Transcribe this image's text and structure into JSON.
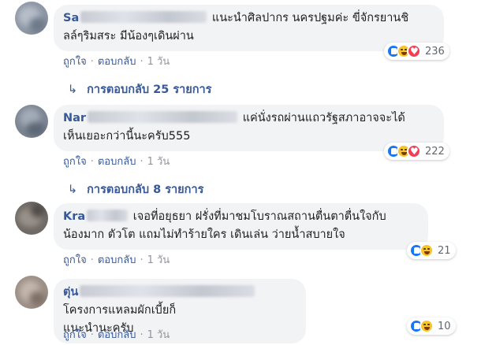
{
  "comments": [
    {
      "name": "Sa▒▒▒▒▒▒▒▒▒▒▒▒▒▒▒",
      "name_visible": "Sa",
      "line1": "แนะนำศิลปากร นครปฐมค่ะ ขี่จักรยานชิ",
      "line2": "ลล์ๆริมสระ มีน้องๆเดินผ่าน",
      "actions": {
        "like": "ถูกใจ",
        "reply": "ตอบกลับ",
        "time": "1 วัน"
      },
      "reaction_icons": [
        "like-icon",
        "haha-icon",
        "love-icon"
      ],
      "reaction_count": "236",
      "replies_label": "การตอบกลับ 25 รายการ"
    },
    {
      "name_visible": "Nar",
      "line1": "แค่นั่งรถผ่านแถวรัฐสภาอาจจะได้",
      "line2": "เห็นเยอะกว่านี้นะครับ555",
      "actions": {
        "like": "ถูกใจ",
        "reply": "ตอบกลับ",
        "time": "1 วัน"
      },
      "reaction_icons": [
        "like-icon",
        "haha-icon",
        "love-icon"
      ],
      "reaction_count": "222",
      "replies_label": "การตอบกลับ 8 รายการ"
    },
    {
      "name_visible": "Kra",
      "line1": "เจอที่อยุธยา ฝรั่งที่มาชมโบราณสถานตื่นตาตื่นใจกับ",
      "line2": "น้องมาก ตัวโต แถมไม่ทำร้ายใคร เดินเล่น ว่ายน้ำสบายใจ",
      "actions": {
        "like": "ถูกใจ",
        "reply": "ตอบกลับ",
        "time": "1 วัน"
      },
      "reaction_icons": [
        "like-icon",
        "haha-icon"
      ],
      "reaction_count": "21"
    },
    {
      "name_visible": "ตุ่น",
      "line1": "โครงการแหลมผักเบี้ยก็",
      "line2": "แนะนำนะครับ",
      "actions": {
        "like": "ถูกใจ",
        "reply": "ตอบกลับ",
        "time": "1 วัน"
      },
      "reaction_icons": [
        "like-icon",
        "haha-icon"
      ],
      "reaction_count": "10"
    }
  ],
  "colors": {
    "bubble": "#f2f3f5",
    "link": "#385898",
    "meta": "#606770",
    "like": "#1877f2",
    "haha": "#f7c52b",
    "love": "#f33e58"
  }
}
